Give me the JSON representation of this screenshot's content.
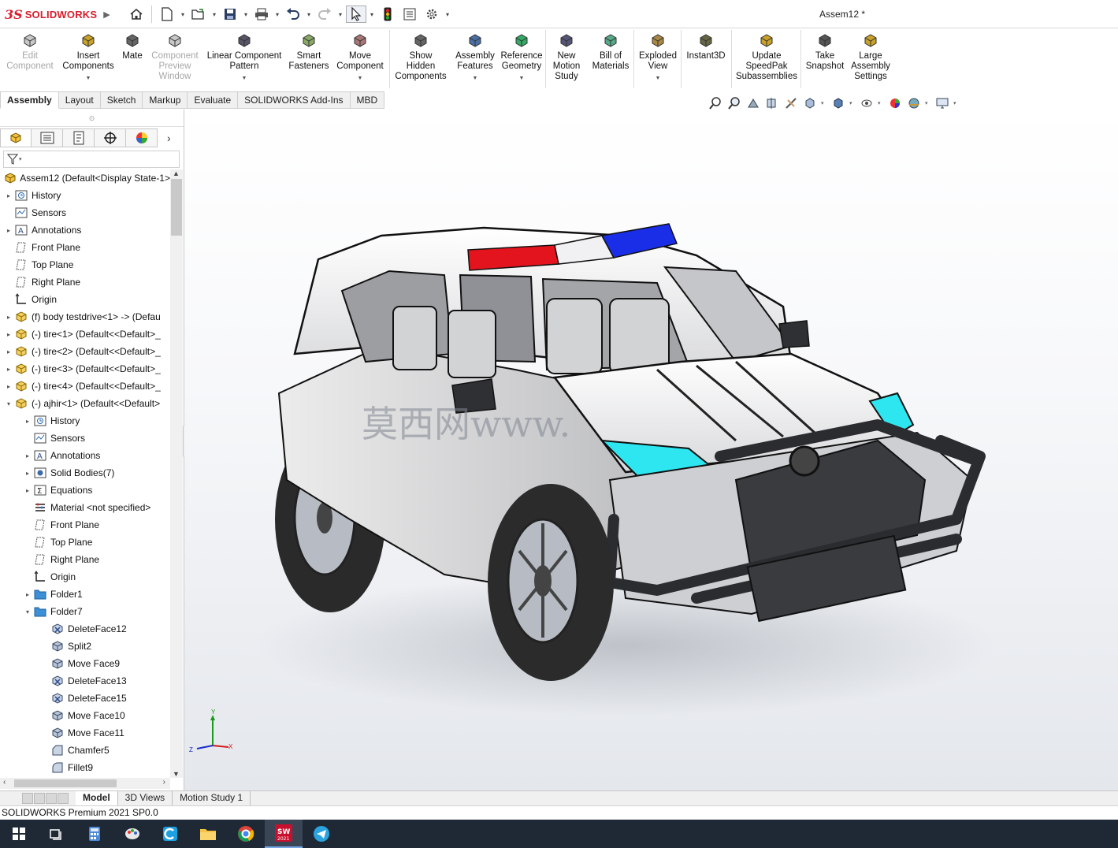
{
  "app": {
    "brand": "SOLIDWORKS",
    "brand_prefix": "3S",
    "document_title": "Assem12 *"
  },
  "quick_access": [
    "home-icon",
    "new-document-icon",
    "open-icon",
    "save-icon",
    "print-icon",
    "undo-icon",
    "redo-icon",
    "select-icon",
    "rebuild-traffic-light-icon",
    "file-properties-icon",
    "options-gear-icon"
  ],
  "commands": [
    {
      "label": [
        "Edit",
        "Component"
      ],
      "disabled": true
    },
    {
      "label": [
        "Insert",
        "Components"
      ],
      "disabled": false,
      "dropdown": true
    },
    {
      "label": [
        "Mate"
      ],
      "disabled": false
    },
    {
      "label": [
        "Component",
        "Preview",
        "Window"
      ],
      "disabled": true
    },
    {
      "label": [
        "Linear Component",
        "Pattern"
      ],
      "disabled": false,
      "dropdown": true
    },
    {
      "label": [
        "Smart",
        "Fasteners"
      ],
      "disabled": false
    },
    {
      "label": [
        "Move",
        "Component"
      ],
      "disabled": false,
      "dropdown": true
    },
    {
      "label": [
        "Show",
        "Hidden",
        "Components"
      ],
      "disabled": false
    },
    {
      "label": [
        "Assembly",
        "Features"
      ],
      "disabled": false,
      "dropdown": true
    },
    {
      "label": [
        "Reference",
        "Geometry"
      ],
      "disabled": false,
      "dropdown": true
    },
    {
      "label": [
        "New",
        "Motion",
        "Study"
      ],
      "disabled": false
    },
    {
      "label": [
        "Bill of",
        "Materials"
      ],
      "disabled": false
    },
    {
      "label": [
        "Exploded",
        "View"
      ],
      "disabled": false,
      "dropdown": true
    },
    {
      "label": [
        "Instant3D"
      ],
      "disabled": false
    },
    {
      "label": [
        "Update",
        "SpeedPak",
        "Subassemblies"
      ],
      "disabled": false
    },
    {
      "label": [
        "Take",
        "Snapshot"
      ],
      "disabled": false
    },
    {
      "label": [
        "Large",
        "Assembly",
        "Settings"
      ],
      "disabled": false
    }
  ],
  "command_tabs": [
    "Assembly",
    "Layout",
    "Sketch",
    "Markup",
    "Evaluate",
    "SOLIDWORKS Add-Ins",
    "MBD"
  ],
  "active_command_tab": "Assembly",
  "panel_tabs": [
    "feature-manager-tab",
    "property-manager-tab",
    "configuration-manager-tab",
    "dimxpert-manager-tab",
    "display-manager-tab"
  ],
  "tree": [
    {
      "label": "Assem12  (Default<Display State-1>",
      "icon": "assembly",
      "level": 0,
      "expander": ""
    },
    {
      "label": "History",
      "icon": "history",
      "level": 1,
      "expander": "▸"
    },
    {
      "label": "Sensors",
      "icon": "sensor",
      "level": 1,
      "expander": ""
    },
    {
      "label": "Annotations",
      "icon": "annotation",
      "level": 1,
      "expander": "▸"
    },
    {
      "label": "Front Plane",
      "icon": "plane",
      "level": 1,
      "expander": ""
    },
    {
      "label": "Top Plane",
      "icon": "plane",
      "level": 1,
      "expander": ""
    },
    {
      "label": "Right Plane",
      "icon": "plane",
      "level": 1,
      "expander": ""
    },
    {
      "label": "Origin",
      "icon": "origin",
      "level": 1,
      "expander": ""
    },
    {
      "label": "(f) body testdrive<1> -> (Defau",
      "icon": "part",
      "level": 1,
      "expander": "▸"
    },
    {
      "label": "(-) tire<1> (Default<<Default>_",
      "icon": "part",
      "level": 1,
      "expander": "▸"
    },
    {
      "label": "(-) tire<2> (Default<<Default>_",
      "icon": "part",
      "level": 1,
      "expander": "▸"
    },
    {
      "label": "(-) tire<3> (Default<<Default>_",
      "icon": "part",
      "level": 1,
      "expander": "▸"
    },
    {
      "label": "(-) tire<4> (Default<<Default>_",
      "icon": "part",
      "level": 1,
      "expander": "▸"
    },
    {
      "label": "(-) ajhir<1> (Default<<Default>",
      "icon": "part",
      "level": 1,
      "expander": "▾"
    },
    {
      "label": "History",
      "icon": "history",
      "level": 2,
      "expander": "▸"
    },
    {
      "label": "Sensors",
      "icon": "sensor",
      "level": 2,
      "expander": ""
    },
    {
      "label": "Annotations",
      "icon": "annotation",
      "level": 2,
      "expander": "▸"
    },
    {
      "label": "Solid Bodies(7)",
      "icon": "solid-bodies",
      "level": 2,
      "expander": "▸"
    },
    {
      "label": "Equations",
      "icon": "equation",
      "level": 2,
      "expander": "▸"
    },
    {
      "label": "Material <not specified>",
      "icon": "material",
      "level": 2,
      "expander": ""
    },
    {
      "label": "Front Plane",
      "icon": "plane",
      "level": 2,
      "expander": ""
    },
    {
      "label": "Top Plane",
      "icon": "plane",
      "level": 2,
      "expander": ""
    },
    {
      "label": "Right Plane",
      "icon": "plane",
      "level": 2,
      "expander": ""
    },
    {
      "label": "Origin",
      "icon": "origin",
      "level": 2,
      "expander": ""
    },
    {
      "label": "Folder1",
      "icon": "folder",
      "level": 2,
      "expander": "▸"
    },
    {
      "label": "Folder7",
      "icon": "folder",
      "level": 2,
      "expander": "▾"
    },
    {
      "label": "DeleteFace12",
      "icon": "feature-delete",
      "level": 3,
      "expander": ""
    },
    {
      "label": "Split2",
      "icon": "feature",
      "level": 3,
      "expander": ""
    },
    {
      "label": "Move Face9",
      "icon": "feature",
      "level": 3,
      "expander": ""
    },
    {
      "label": "DeleteFace13",
      "icon": "feature-delete",
      "level": 3,
      "expander": ""
    },
    {
      "label": "DeleteFace15",
      "icon": "feature-delete",
      "level": 3,
      "expander": ""
    },
    {
      "label": "Move Face10",
      "icon": "feature",
      "level": 3,
      "expander": ""
    },
    {
      "label": "Move Face11",
      "icon": "feature",
      "level": 3,
      "expander": ""
    },
    {
      "label": "Chamfer5",
      "icon": "chamfer",
      "level": 3,
      "expander": ""
    },
    {
      "label": "Fillet9",
      "icon": "fillet",
      "level": 3,
      "expander": ""
    }
  ],
  "viewport": {
    "watermark": "莫西网www.",
    "model_description": "police SUV assembly",
    "triad_labels": {
      "x": "X",
      "y": "Y",
      "z": "Z"
    }
  },
  "bottom_tabs": [
    "Model",
    "3D Views",
    "Motion Study 1"
  ],
  "active_bottom_tab": "Model",
  "status_text": "SOLIDWORKS Premium 2021 SP0.0",
  "taskbar": [
    "windows-start-icon",
    "task-view-icon",
    "calculator-icon",
    "paint-icon",
    "cortana-icon",
    "file-explorer-icon",
    "chrome-icon",
    "solidworks-2021-icon",
    "telegram-icon"
  ],
  "colors": {
    "brand_red": "#d81e2c",
    "taskbar": "#1f2936",
    "headlight": "#2ee6f0",
    "lightbar_red": "#e3141d",
    "lightbar_blue": "#1a2ee8"
  }
}
